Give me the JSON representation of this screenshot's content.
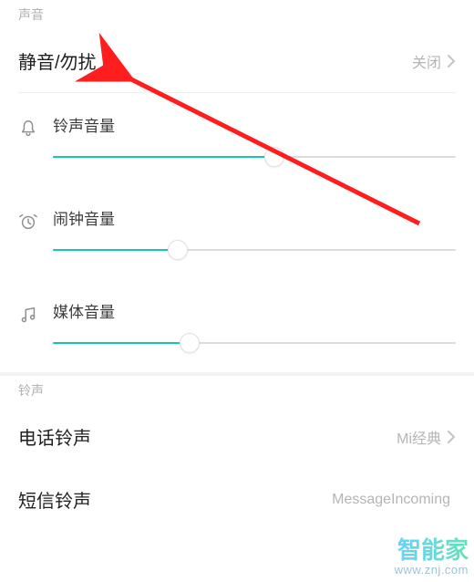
{
  "sections": {
    "sound_label": "声音",
    "ringtone_label": "铃声"
  },
  "dnd": {
    "title": "静音/勿扰",
    "value": "关闭"
  },
  "sliders": {
    "ringer": {
      "label": "铃声音量",
      "percent": 55
    },
    "alarm": {
      "label": "闹钟音量",
      "percent": 31
    },
    "media": {
      "label": "媒体音量",
      "percent": 34
    }
  },
  "ringtones": {
    "phone": {
      "title": "电话铃声",
      "value": "Mi经典"
    },
    "sms": {
      "title": "短信铃声",
      "value": "MessageIncoming"
    }
  },
  "watermark": {
    "logo": "智能家",
    "url": "www.znj.com"
  }
}
